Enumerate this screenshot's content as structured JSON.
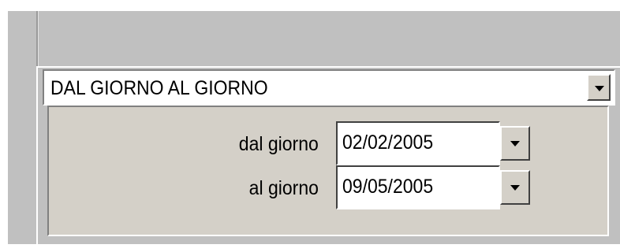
{
  "period_select": {
    "value": "DAL GIORNO AL GIORNO",
    "dropdown_icon": "chevron-down-icon"
  },
  "date_range": {
    "from_label": "dal giorno",
    "from_value": "02/02/2005",
    "to_label": "al giorno",
    "to_value": "09/05/2005"
  },
  "colors": {
    "window_bg": "#c0c0c0",
    "panel_bg": "#d4d0c8",
    "field_bg": "#ffffff"
  }
}
